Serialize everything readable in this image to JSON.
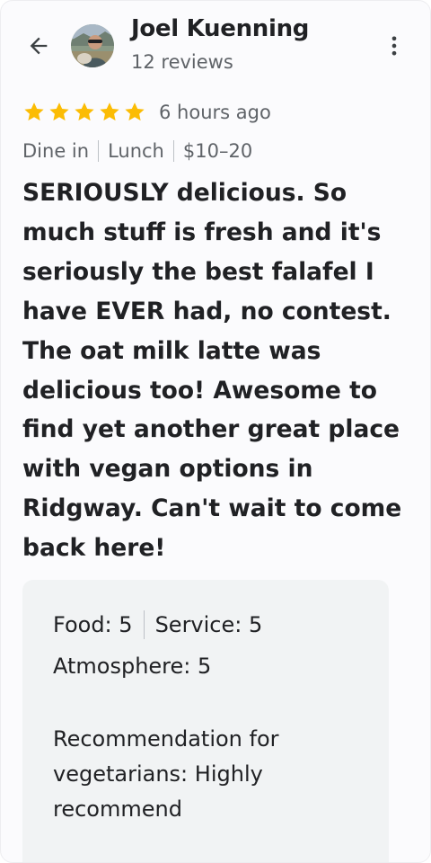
{
  "header": {
    "user_name": "Joel Kuenning",
    "review_count": "12 reviews"
  },
  "review": {
    "rating": 5,
    "max_rating": 5,
    "star_color": "#fbbc04",
    "time_ago": "6 hours ago",
    "meta": [
      "Dine in",
      "Lunch",
      "$10–20"
    ],
    "text": "SERIOUSLY delicious. So much stuff is fresh and it's seriously the best falafel I have EVER had, no contest. The oat milk latte was delicious too! Awesome to find yet another great place with vegan options in Ridgway. Can't wait to come back here!"
  },
  "ratings_card": {
    "food_label": "Food:",
    "food_value": "5",
    "service_label": "Service:",
    "service_value": "5",
    "atmosphere_label": "Atmosphere:",
    "atmosphere_value": "5",
    "recommendation_label": "Recommendation for vegetarians:",
    "recommendation_value": "Highly recommend"
  },
  "icons": {
    "back": "arrow-back-icon",
    "more": "more-vert-icon",
    "star": "star-icon"
  }
}
